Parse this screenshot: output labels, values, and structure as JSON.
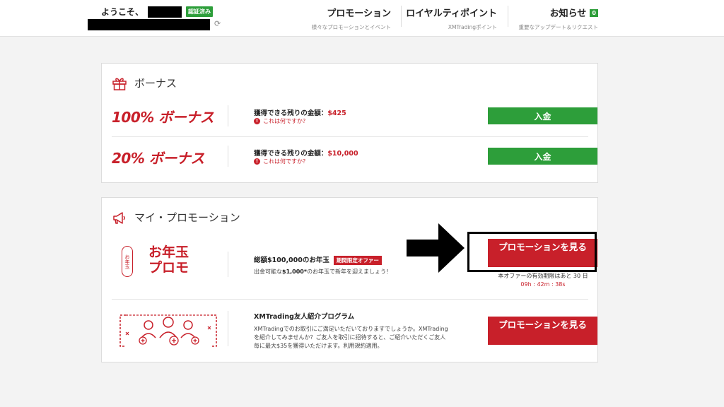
{
  "header": {
    "welcome": "ようこそ、",
    "verified_badge": "認証済み",
    "nav": [
      {
        "title": "プロモーション",
        "sub": "様々なプロモーションとイベント"
      },
      {
        "title": "ロイヤルティポイント",
        "sub": "XMTradingポイント"
      },
      {
        "title": "お知らせ",
        "sub": "重要なアップデート＆リクエスト",
        "badge": "0"
      }
    ]
  },
  "bonus": {
    "title": "ボーナス",
    "rows": [
      {
        "name": "100% ボーナス",
        "label": "獲得できる残りの金額：",
        "amount": "$425",
        "help": "これは何ですか？",
        "button": "入金"
      },
      {
        "name": "20% ボーナス",
        "label": "獲得できる残りの金額：",
        "amount": "$10,000",
        "help": "これは何ですか？",
        "button": "入金"
      }
    ]
  },
  "promotions": {
    "title": "マイ・プロモーション",
    "items": [
      {
        "logo_line1": "お年玉",
        "logo_line2": "プロモ",
        "logo_stamp": "お年玉",
        "title": "総額$100,000のお年玉",
        "badge": "期間限定オファー",
        "desc_prefix": "出金可能な",
        "desc_bold": "$1,000*",
        "desc_suffix": "のお年玉で新年を迎えましょう！",
        "button": "プロモーションを見る",
        "offer_text": "本オファーの有効期限はあと 30 日",
        "countdown": "09h : 42m : 38s"
      },
      {
        "title": "XMTrading友人紹介プログラム",
        "desc_lines": [
          "XMTradingでのお取引にご満足いただいておりますでしょうか。XMTrading",
          "を紹介してみませんか？ご友人を取引に招待すると、ご紹介いただくご友人",
          "毎に最大$35を獲得いただけます。利用規約適用。"
        ],
        "button": "プロモーションを見る"
      }
    ]
  },
  "colors": {
    "green": "#2d9e3a",
    "red": "#c8202a"
  }
}
